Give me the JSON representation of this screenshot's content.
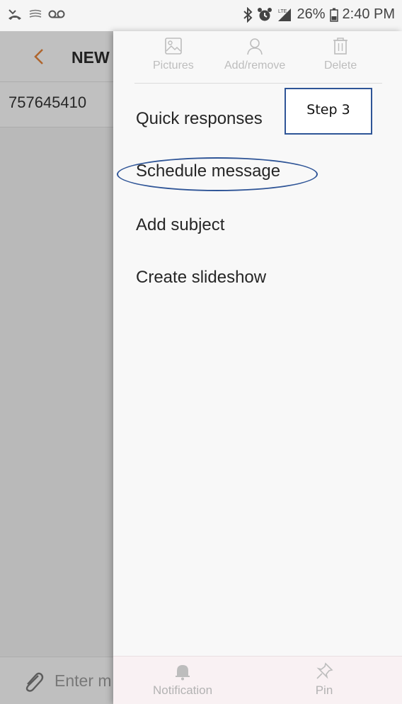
{
  "status_bar": {
    "battery_percent": "26%",
    "time": "2:40 PM",
    "left_icons": [
      "missed-call-icon",
      "voicemail-icon"
    ],
    "right_icons": [
      "bluetooth-icon",
      "alarm-icon",
      "lte-signal-icon",
      "battery-icon"
    ]
  },
  "compose": {
    "title": "NEW",
    "recipient": "757645410",
    "input_placeholder": "Enter m"
  },
  "drawer": {
    "actions": [
      {
        "label": "Pictures",
        "icon": "picture-icon"
      },
      {
        "label": "Add/remove",
        "icon": "person-icon"
      },
      {
        "label": "Delete",
        "icon": "trash-icon"
      }
    ],
    "menu": [
      {
        "label": "Quick responses"
      },
      {
        "label": "Schedule message"
      },
      {
        "label": "Add subject"
      },
      {
        "label": "Create slideshow"
      }
    ],
    "bottom": [
      {
        "label": "Notification",
        "icon": "bell-icon"
      },
      {
        "label": "Pin",
        "icon": "pin-icon"
      }
    ]
  },
  "annotation": {
    "step_label": "Step 3",
    "color": "#2f5597"
  },
  "colors": {
    "accent_back": "#e0823a",
    "drawer_bg": "#f8f8f8",
    "bottom_bar_bg": "#f9f1f3"
  }
}
